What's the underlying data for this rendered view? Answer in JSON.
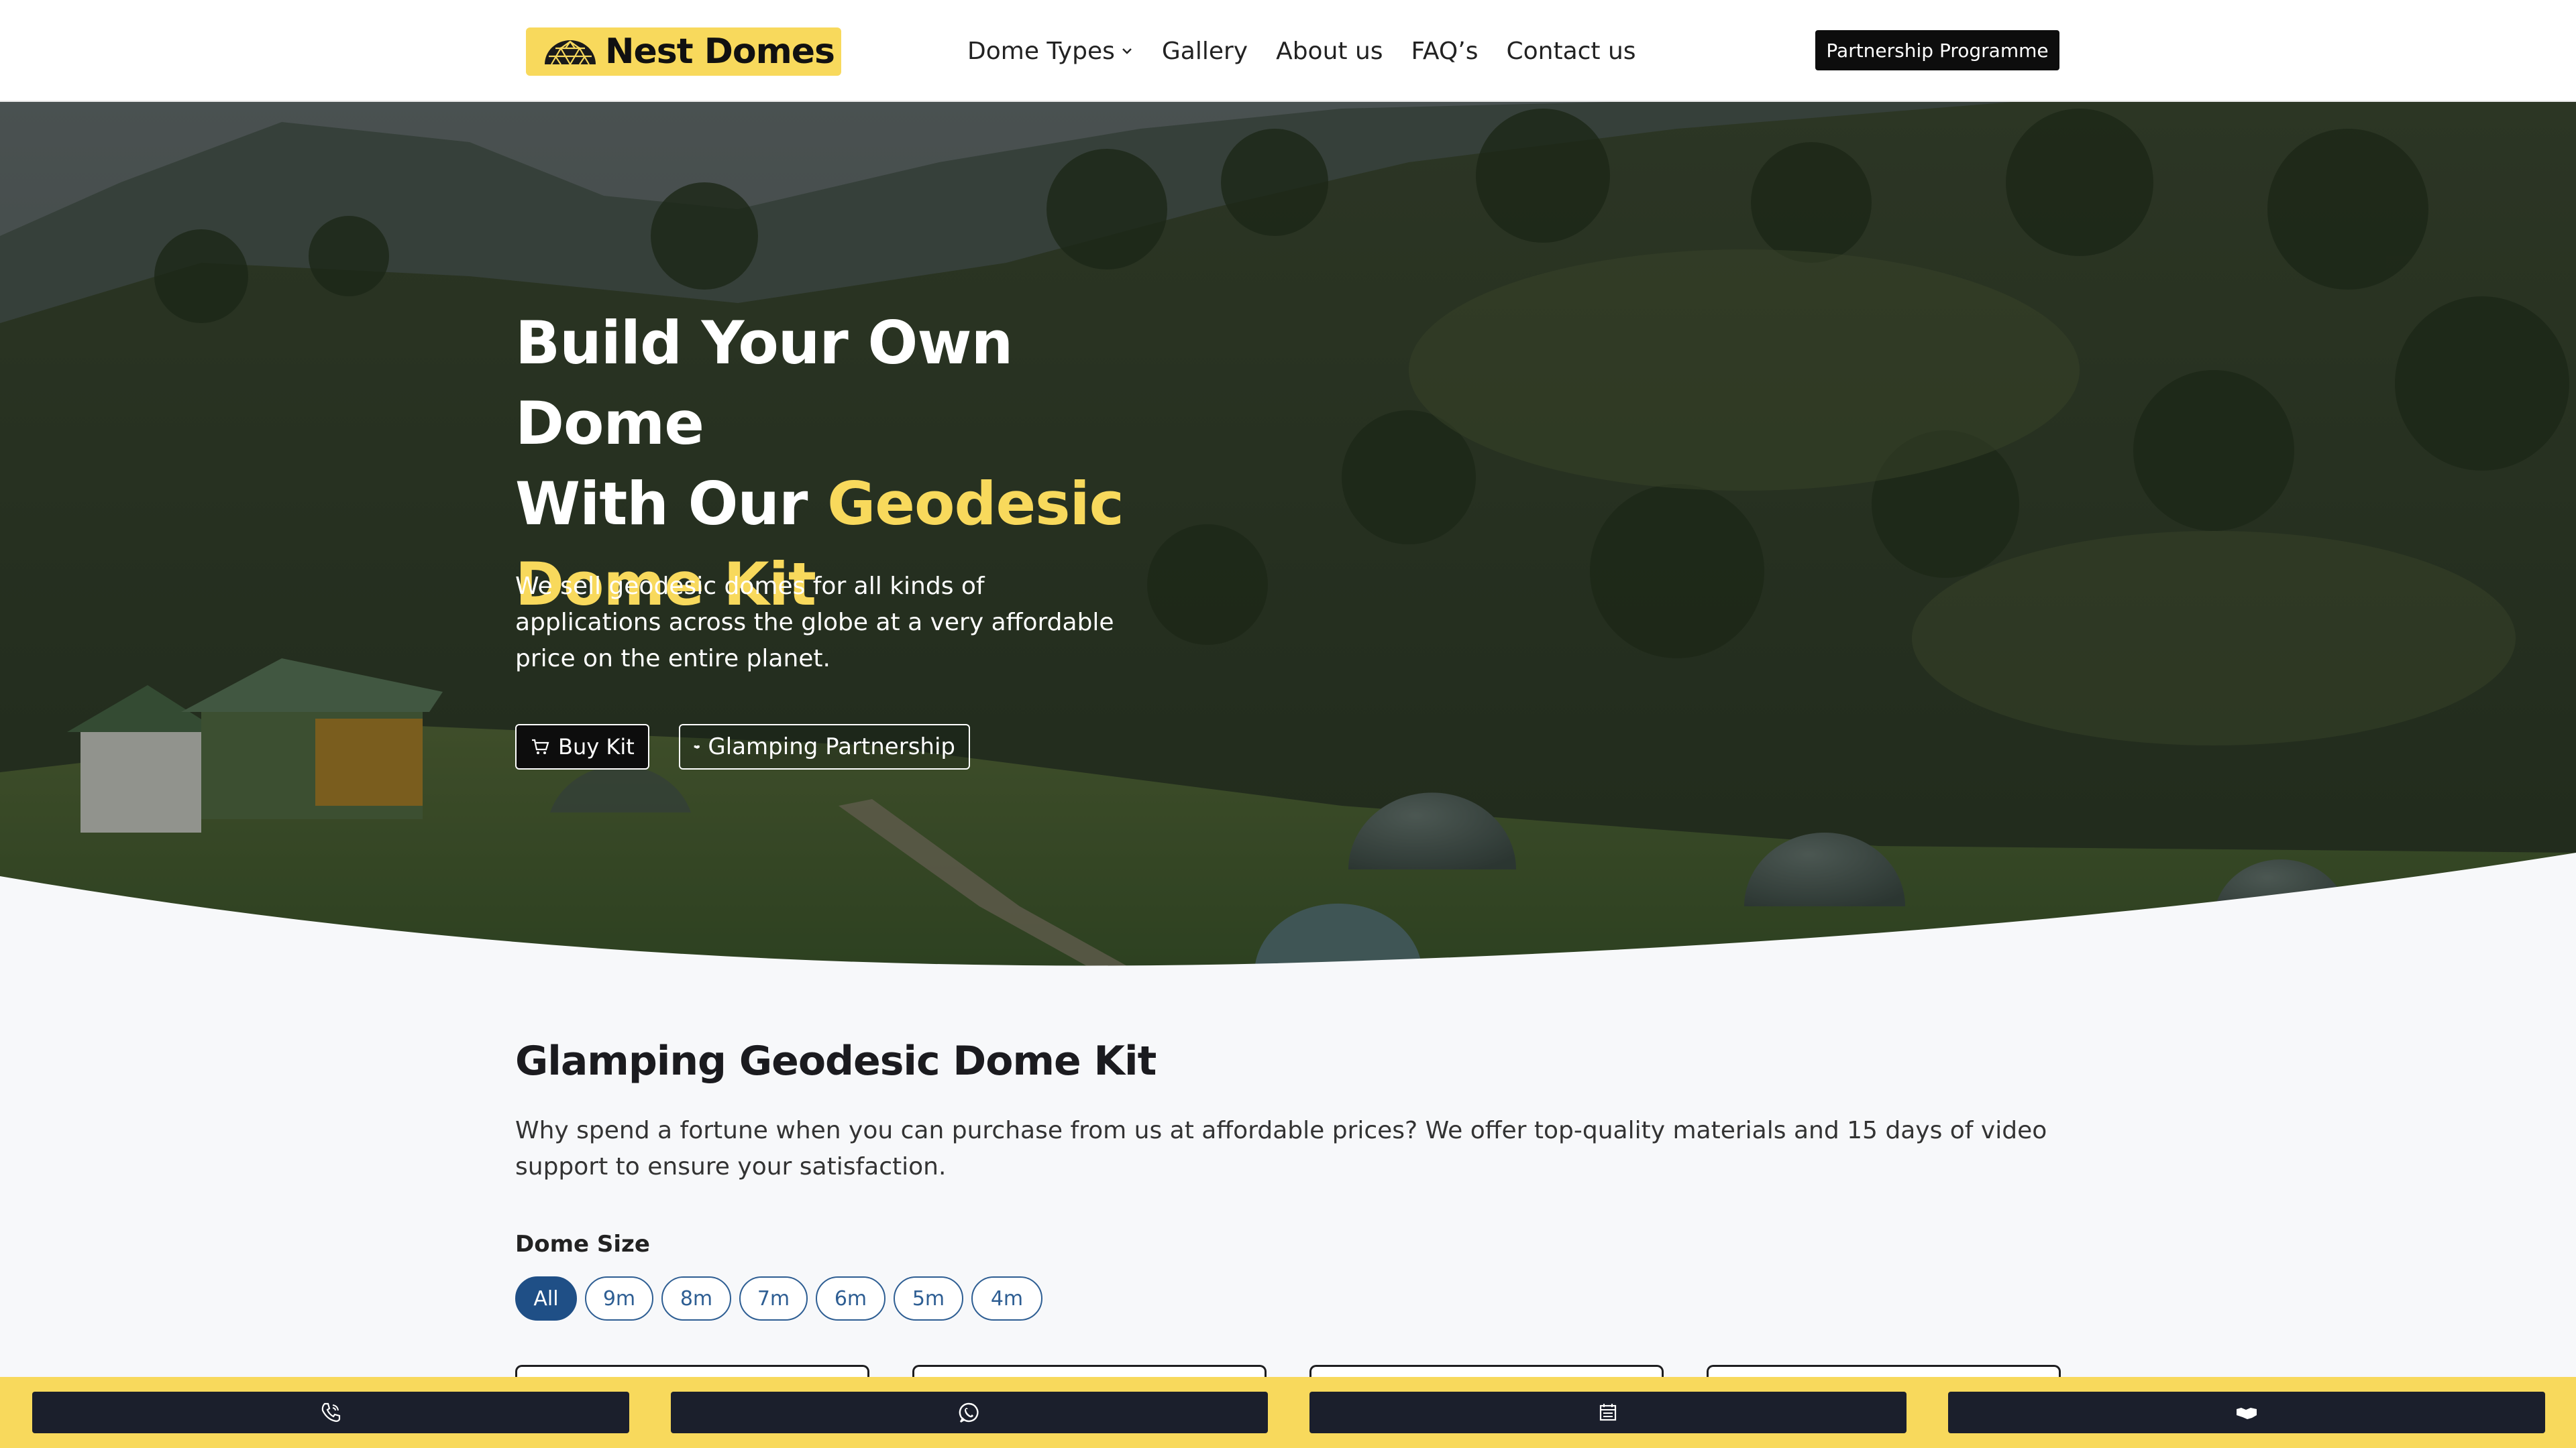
{
  "header": {
    "logo_text": "Nest Domes",
    "nav": [
      {
        "label": "Dome Types",
        "dropdown": true
      },
      {
        "label": "Gallery"
      },
      {
        "label": "About us"
      },
      {
        "label": "FAQ’s"
      },
      {
        "label": "Contact us"
      }
    ],
    "partner_button": "Partnership Programme"
  },
  "hero": {
    "title_part1": "Build Your Own Dome",
    "title_part2": "With Our ",
    "title_highlight1": "Geodesic",
    "title_highlight2": "Dome Kit",
    "description": "We sell geodesic domes for all kinds of applications across the globe at a very affordable price on the entire planet.",
    "buy_button": "Buy Kit",
    "glamping_button": "Glamping Partnership"
  },
  "products": {
    "title": "Glamping Geodesic Dome Kit",
    "description": "Why spend a fortune when you can purchase from us at affordable prices? We offer top-quality materials and 15 days of video support to ensure your satisfaction.",
    "size_label": "Dome Size",
    "filters": [
      "All",
      "9m",
      "8m",
      "7m",
      "6m",
      "5m",
      "4m"
    ],
    "active_filter": "All"
  },
  "bottom_bar": {
    "icons": [
      "phone-icon",
      "whatsapp-icon",
      "calendar-icon",
      "handshake-icon"
    ]
  },
  "colors": {
    "brand_yellow": "#f8d95c",
    "dark": "#0d0d0d",
    "chip_blue": "#1f4f86",
    "bar_dark": "#1b1f2c",
    "page_bg": "#f7f8fa"
  }
}
